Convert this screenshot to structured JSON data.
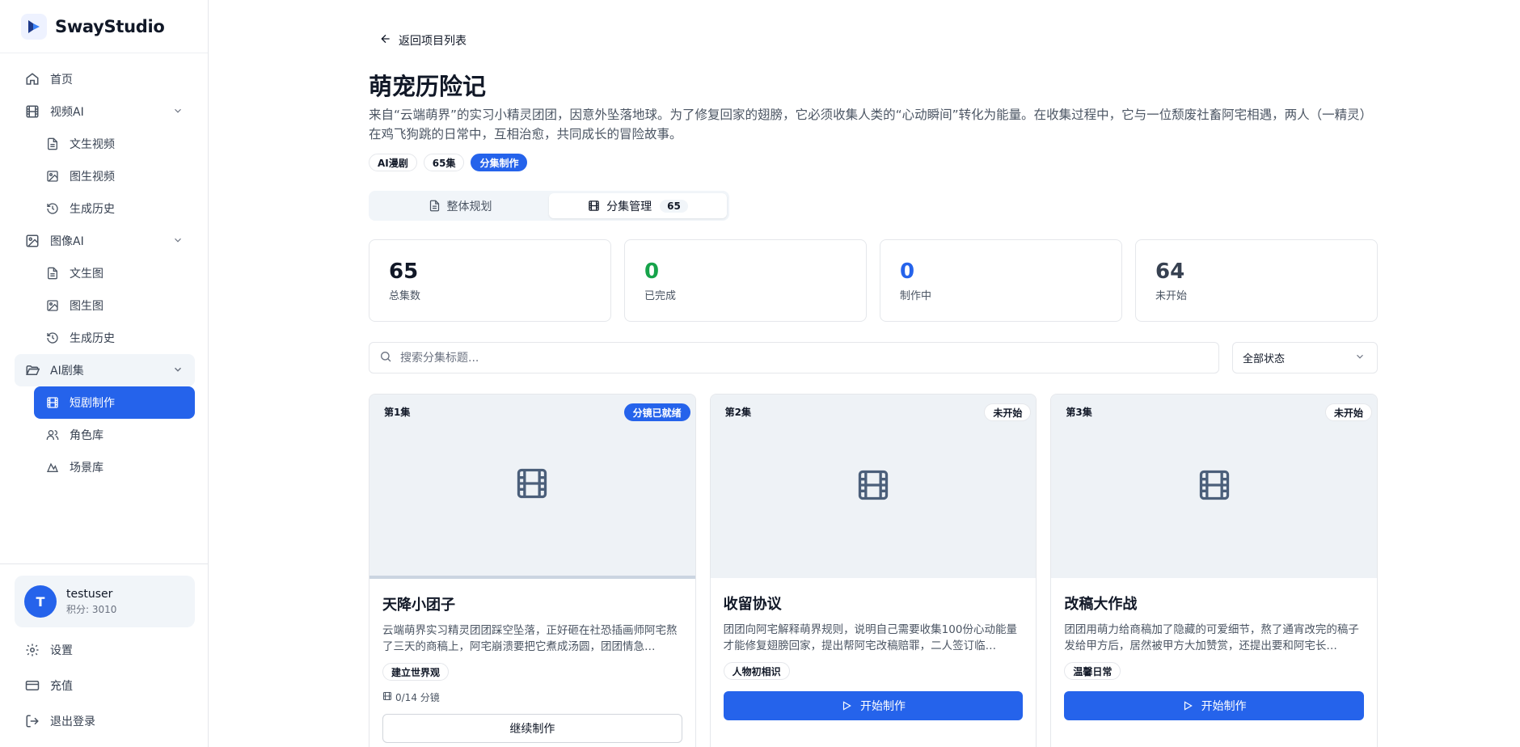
{
  "app": {
    "name": "SwayStudio"
  },
  "sidebar": {
    "home": "首页",
    "video_ai": {
      "label": "视频AI",
      "items": [
        "文生视频",
        "图生视频",
        "生成历史"
      ]
    },
    "image_ai": {
      "label": "图像AI",
      "items": [
        "文生图",
        "图生图",
        "生成历史"
      ]
    },
    "drama_ai": {
      "label": "AI剧集",
      "items": [
        "短剧制作",
        "角色库",
        "场景库"
      ]
    },
    "user": {
      "initial": "T",
      "name": "testuser",
      "points": "积分: 3010"
    },
    "bottom": [
      "设置",
      "充值",
      "退出登录"
    ]
  },
  "project": {
    "back": "返回项目列表",
    "title": "萌宠历险记",
    "description": "来自“云端萌界”的实习小精灵团团，因意外坠落地球。为了修复回家的翅膀，它必须收集人类的“心动瞬间”转化为能量。在收集过程中，它与一位颓废社畜阿宅相遇，两人（一精灵）在鸡飞狗跳的日常中，互相治愈，共同成长的冒险故事。",
    "tags": [
      "AI漫剧",
      "65集",
      "分集制作"
    ]
  },
  "tabs": {
    "overview": "整体规划",
    "episodes": "分集管理",
    "episodes_count": "65"
  },
  "stats": [
    {
      "value": "65",
      "label": "总集数",
      "color": "#111827"
    },
    {
      "value": "0",
      "label": "已完成",
      "color": "#16a34a"
    },
    {
      "value": "0",
      "label": "制作中",
      "color": "#2563eb"
    },
    {
      "value": "64",
      "label": "未开始",
      "color": "#374151"
    }
  ],
  "filters": {
    "search_placeholder": "搜索分集标题...",
    "status": "全部状态"
  },
  "episodes": [
    {
      "ep": "第1集",
      "status": "分镜已就绪",
      "title": "天降小团子",
      "desc": "云端萌界实习精灵团团踩空坠落，正好砸在社恐插画师阿宅熬了三天的商稿上，阿宅崩溃要把它煮成汤圆，团团情急…",
      "tag": "建立世界观",
      "progress": "0/14 分镜",
      "action": "继续制作"
    },
    {
      "ep": "第2集",
      "status": "未开始",
      "title": "收留协议",
      "desc": "团团向阿宅解释萌界规则，说明自己需要收集100份心动能量才能修复翅膀回家，提出帮阿宅改稿赔罪，二人签订临…",
      "tag": "人物初相识",
      "action": "开始制作"
    },
    {
      "ep": "第3集",
      "status": "未开始",
      "title": "改稿大作战",
      "desc": "团团用萌力给商稿加了隐藏的可爱细节，熬了通宵改完的稿子发给甲方后，居然被甲方大加赞赏，还提出要和阿宅长…",
      "tag": "温馨日常",
      "action": "开始制作"
    }
  ],
  "colors": {
    "accent": "#2563eb",
    "completed": "#16a34a"
  }
}
